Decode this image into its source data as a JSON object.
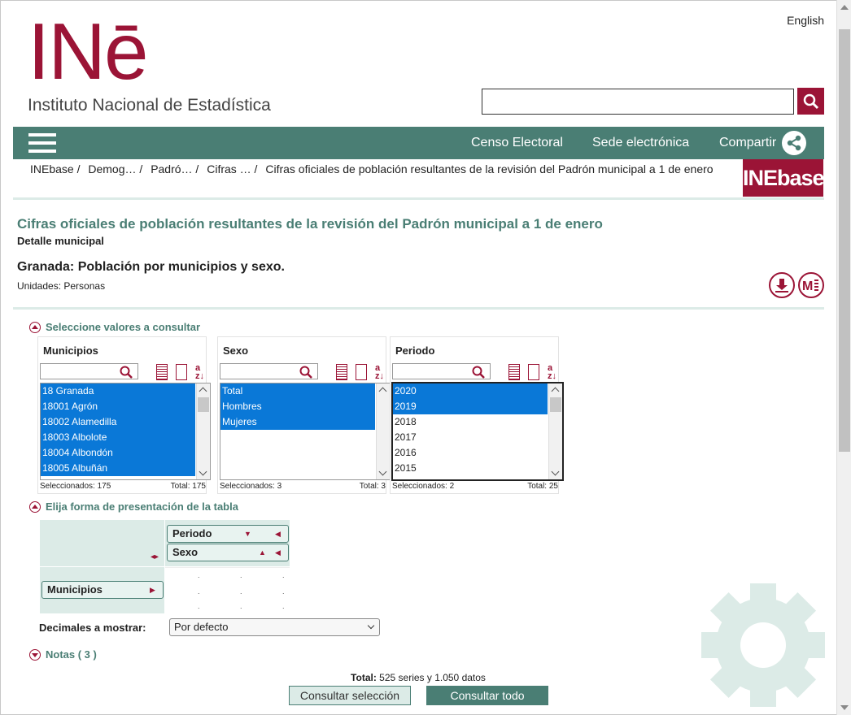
{
  "header": {
    "lang": "English",
    "logo_mark": "INē",
    "logo_text": "Instituto Nacional de Estadística",
    "search_value": ""
  },
  "nav": {
    "links": [
      "Censo Electoral",
      "Sede electrónica",
      "Compartir"
    ]
  },
  "breadcrumb": [
    "INEbase /",
    "Demog… /",
    "Padró… /",
    "Cifras … /",
    "Cifras oficiales de población resultantes de la revisión del Padrón municipal a 1 de enero"
  ],
  "inebase_logo": "INEbase",
  "page": {
    "title": "Cifras oficiales de población resultantes de la revisión del Padrón municipal a 1 de enero",
    "subtitle": "Detalle municipal",
    "table_title": "Granada: Población por municipios y sexo.",
    "units": "Unidades:  Personas",
    "download_icon": "download-icon",
    "mobile_icon": "metadata-icon"
  },
  "select_section": "Seleccione valores a consultar",
  "variables": [
    {
      "name": "Municipios",
      "items": [
        "18 Granada",
        "18001 Agrón",
        "18002 Alamedilla",
        "18003 Albolote",
        "18004 Albondón",
        "18005 Albuñán"
      ],
      "selected": [
        true,
        true,
        true,
        true,
        true,
        true
      ],
      "selected_label": "Seleccionados: 175",
      "total_label": "Total: 175"
    },
    {
      "name": "Sexo",
      "items": [
        "Total",
        "Hombres",
        "Mujeres"
      ],
      "selected": [
        true,
        true,
        true
      ],
      "selected_label": "Seleccionados: 3",
      "total_label": "Total: 3"
    },
    {
      "name": "Periodo",
      "items": [
        "2020",
        "2019",
        "2018",
        "2017",
        "2016",
        "2015"
      ],
      "selected": [
        true,
        true,
        false,
        false,
        false,
        false
      ],
      "selected_label": "Seleccionados: 2",
      "total_label": "Total: 25"
    }
  ],
  "layout_section": "Elija forma de presentación de la tabla",
  "layout": {
    "columns": [
      "Periodo",
      "Sexo"
    ],
    "rows": [
      "Municipios"
    ]
  },
  "decimals": {
    "label": "Decimales a mostrar:",
    "value": "Por defecto"
  },
  "notes": "Notas ( 3 )",
  "footer": {
    "total_label": "Total:",
    "total_value": "525 series y  1.050 datos",
    "btn_selection": "Consultar selección",
    "btn_all": "Consultar todo"
  },
  "colors": {
    "brand": "#9b1436",
    "teal": "#4a7e74",
    "selection": "#0a78d7"
  }
}
